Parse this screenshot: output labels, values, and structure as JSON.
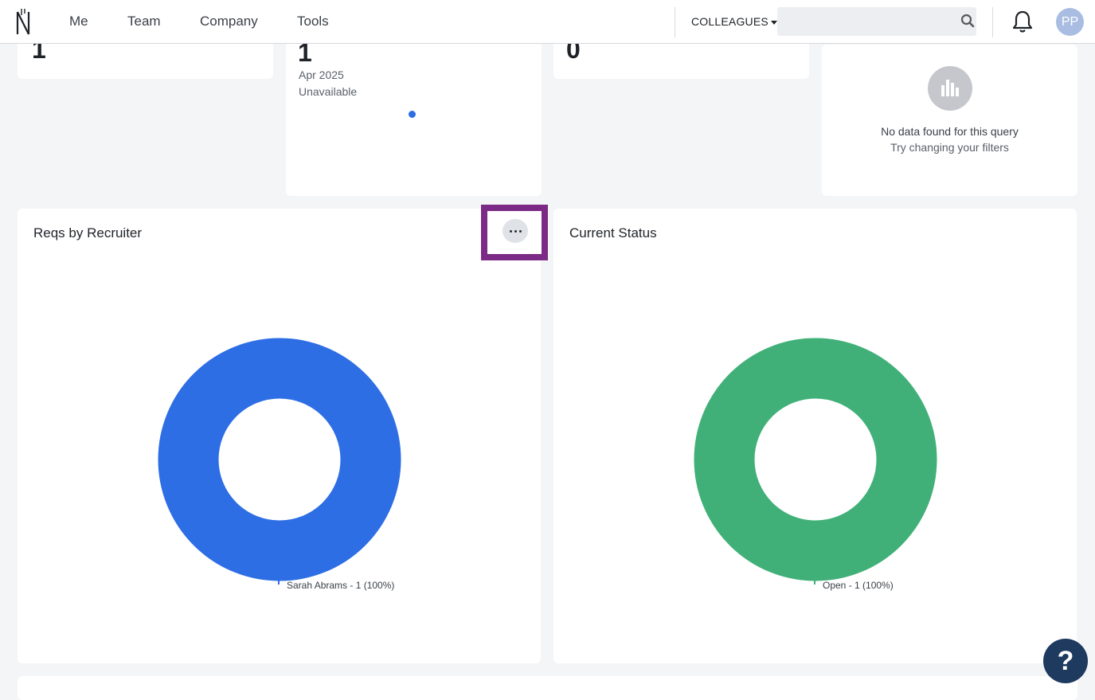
{
  "navbar": {
    "items": [
      "Me",
      "Team",
      "Company",
      "Tools"
    ],
    "colleagues_label": "COLLEAGUES",
    "search_placeholder": "",
    "avatar_initials": "PP"
  },
  "kpi_cards": [
    {
      "value": "1"
    },
    {
      "value": "1",
      "period": "Apr 2025",
      "status": "Unavailable"
    },
    {
      "value": "0"
    }
  ],
  "nodata_card": {
    "title": "No data found for this query",
    "subtitle": "Try changing your filters"
  },
  "charts": {
    "recruiter": {
      "title": "Reqs by Recruiter",
      "legend": "Sarah Abrams - 1 (100%)"
    },
    "status": {
      "title": "Current Status",
      "legend": "Open - 1 (100%)"
    }
  },
  "help_label": "?",
  "colors": {
    "donut_blue": "#2d6ee5",
    "donut_green": "#41b078",
    "highlight": "#7b2a85",
    "help_bg": "#1e3a5f"
  },
  "chart_data": [
    {
      "type": "pie",
      "title": "Reqs by Recruiter",
      "categories": [
        "Sarah Abrams"
      ],
      "values": [
        1
      ],
      "labels": [
        "Sarah Abrams - 1 (100%)"
      ]
    },
    {
      "type": "pie",
      "title": "Current Status",
      "categories": [
        "Open"
      ],
      "values": [
        1
      ],
      "labels": [
        "Open - 1 (100%)"
      ]
    }
  ]
}
